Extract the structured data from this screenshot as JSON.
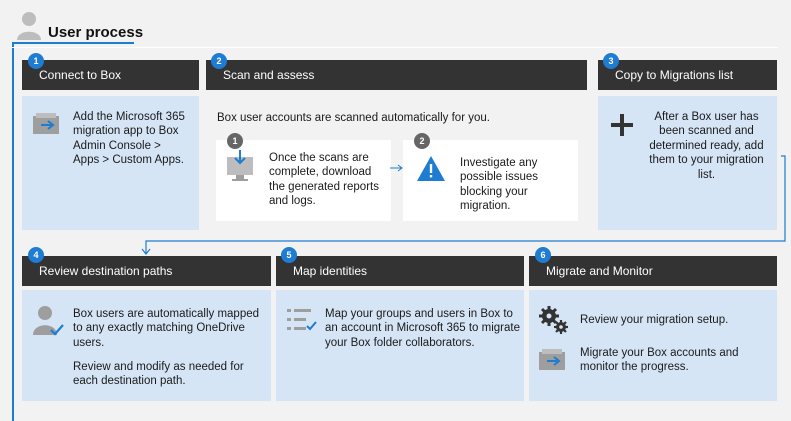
{
  "title": "User process",
  "steps": [
    {
      "num": "1",
      "header": "Connect to Box",
      "text": "Add the Microsoft 365 migration app to Box Admin Console > Apps > Custom Apps."
    },
    {
      "num": "2",
      "header": "Scan and assess",
      "intro": "Box user accounts are scanned automatically for you.",
      "substeps": [
        {
          "num": "1",
          "text": "Once the scans are complete, download the generated reports and logs."
        },
        {
          "num": "2",
          "text": "Investigate any possible issues blocking your migration."
        }
      ]
    },
    {
      "num": "3",
      "header": "Copy to Migrations list",
      "text": "After a Box user has been scanned and determined ready, add them to your migration list."
    },
    {
      "num": "4",
      "header": "Review destination paths",
      "text": "Box users are automatically mapped to any exactly matching OneDrive users.",
      "text2": "Review and modify as needed for each destination path."
    },
    {
      "num": "5",
      "header": "Map identities",
      "text": "Map your groups and users in Box to an account in Microsoft 365 to migrate your Box folder collaborators."
    },
    {
      "num": "6",
      "header": "Migrate and Monitor",
      "text": "Review your migration setup.",
      "text2": "Migrate your Box accounts and monitor the progress."
    }
  ],
  "icons": [
    "user-icon",
    "migrate-box-icon",
    "download-monitor-icon",
    "warning-icon",
    "plus-icon",
    "user-check-icon",
    "map-list-icon",
    "gears-icon"
  ],
  "colors": {
    "accent": "#1e7cd2",
    "header_bar": "#333333",
    "panel": "#d6e5f6"
  }
}
